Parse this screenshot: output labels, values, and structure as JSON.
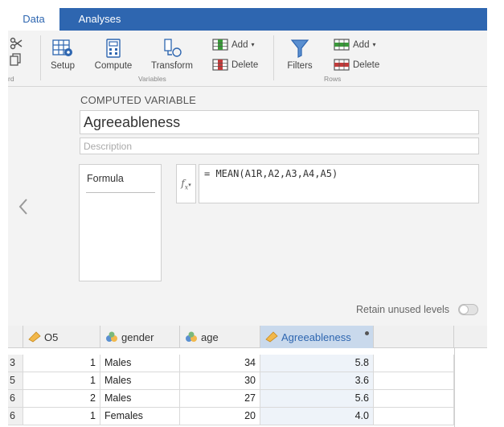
{
  "tabs": [
    {
      "label": "Data",
      "active": true
    },
    {
      "label": "Analyses",
      "active": false
    }
  ],
  "ribbon": {
    "clipboard_label": "rd",
    "setup_label": "Setup",
    "compute_label": "Compute",
    "transform_label": "Transform",
    "variables_group_label": "Variables",
    "var_add_label": "Add",
    "var_delete_label": "Delete",
    "filters_label": "Filters",
    "row_add_label": "Add",
    "row_delete_label": "Delete",
    "rows_group_label": "Rows"
  },
  "editor": {
    "section_title": "COMPUTED VARIABLE",
    "variable_name": "Agreeableness",
    "description_placeholder": "Description",
    "formula_tab_label": "Formula",
    "formula": "= MEAN(A1R,A2,A3,A4,A5)",
    "retain_label": "Retain unused levels",
    "retain_on": false
  },
  "sheet": {
    "columns": [
      {
        "label": "O5",
        "icon": "ordinal-ruler-icon"
      },
      {
        "label": "gender",
        "icon": "nominal-circles-icon"
      },
      {
        "label": "age",
        "icon": "nominal-circles-icon"
      },
      {
        "label": "Agreeableness",
        "icon": "ordinal-ruler-icon",
        "selected": true
      }
    ],
    "rows": [
      {
        "rownum": "3",
        "o5": "1",
        "gender": "Males",
        "age": "34",
        "agree": "5.8"
      },
      {
        "rownum": "5",
        "o5": "1",
        "gender": "Males",
        "age": "30",
        "agree": "3.6"
      },
      {
        "rownum": "6",
        "o5": "2",
        "gender": "Males",
        "age": "27",
        "agree": "5.6"
      },
      {
        "rownum": "6",
        "o5": "1",
        "gender": "Females",
        "age": "20",
        "agree": "4.0"
      }
    ]
  },
  "colors": {
    "accent": "#2e66b0",
    "selected_header": "#c9d9ec"
  }
}
